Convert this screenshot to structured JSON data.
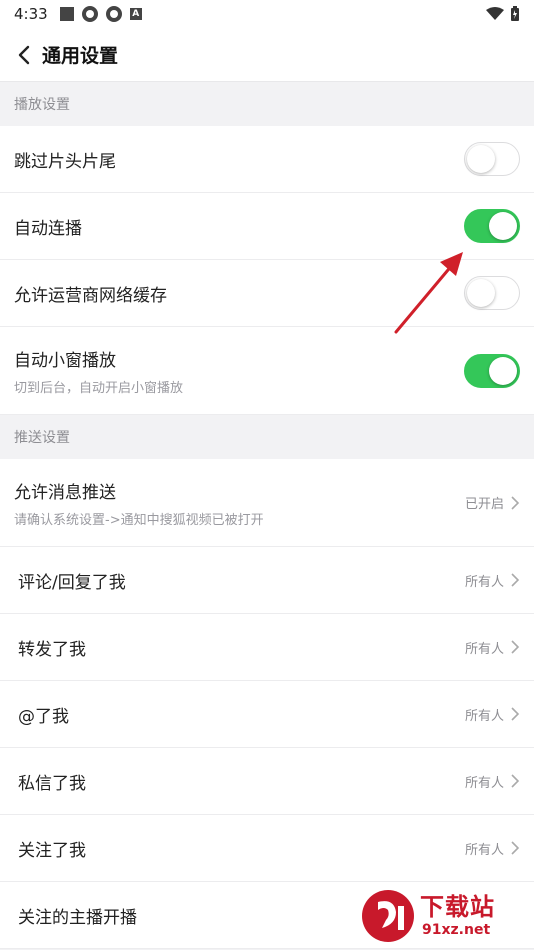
{
  "status_bar": {
    "time": "4:33"
  },
  "header": {
    "title": "通用设置"
  },
  "sections": {
    "playback": {
      "title": "播放设置",
      "items": [
        {
          "label": "跳过片头片尾",
          "toggle_on": false
        },
        {
          "label": "自动连播",
          "toggle_on": true
        },
        {
          "label": "允许运营商网络缓存",
          "toggle_on": false
        },
        {
          "label": "自动小窗播放",
          "sub": "切到后台，自动开启小窗播放",
          "toggle_on": true
        }
      ]
    },
    "push": {
      "title": "推送设置",
      "items": [
        {
          "label": "允许消息推送",
          "sub": "请确认系统设置->通知中搜狐视频已被打开",
          "value": "已开启"
        },
        {
          "label": "评论/回复了我",
          "value": "所有人"
        },
        {
          "label": "转发了我",
          "value": "所有人"
        },
        {
          "label": "@了我",
          "value": "所有人"
        },
        {
          "label": "私信了我",
          "value": "所有人"
        },
        {
          "label": "关注了我",
          "value": "所有人"
        },
        {
          "label": "关注的主播开播",
          "value": ""
        }
      ]
    }
  },
  "watermark": {
    "name": "下载站",
    "url": "91xz.net"
  },
  "colors": {
    "toggle_on": "#34c759",
    "annotation_arrow": "#d0202a"
  }
}
